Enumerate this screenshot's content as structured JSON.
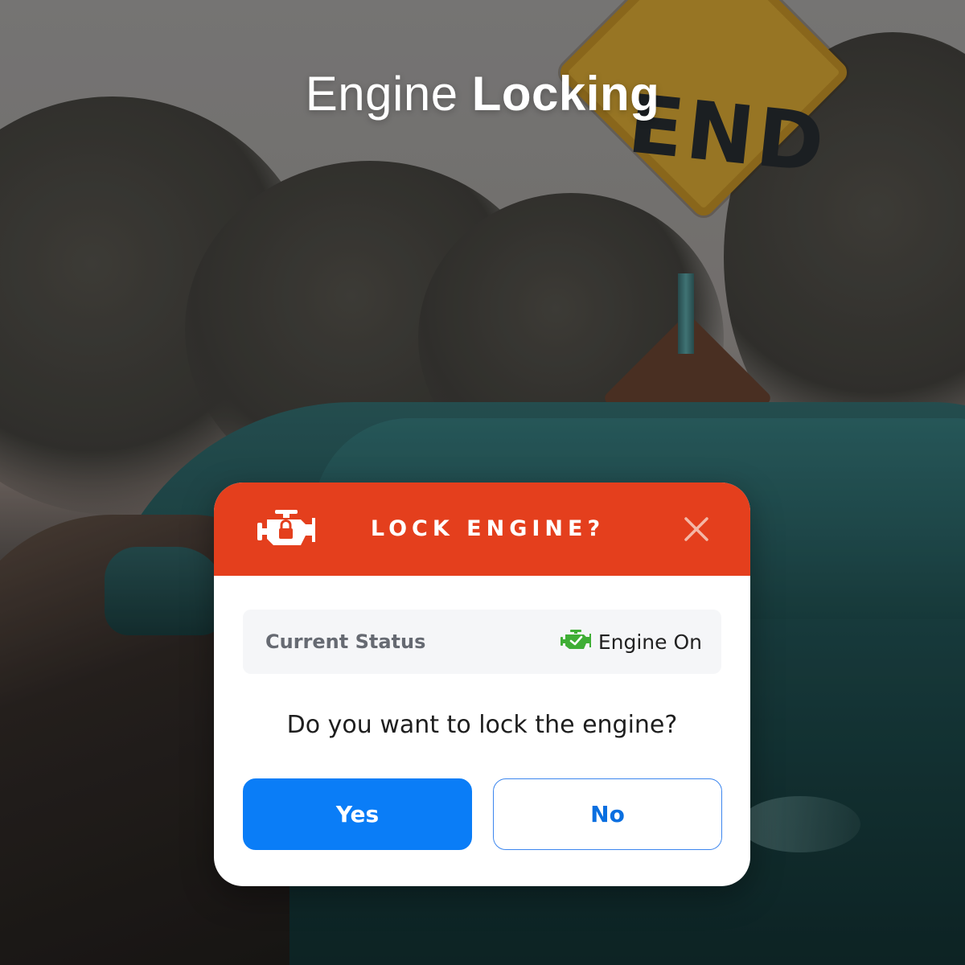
{
  "headline": {
    "light": "Engine",
    "bold": "Locking"
  },
  "background": {
    "sign_text": "END"
  },
  "dialog": {
    "title": "LOCK ENGINE?",
    "header_icon": "engine-lock-icon",
    "close_icon": "close-icon",
    "status": {
      "label": "Current Status",
      "value": "Engine On",
      "value_icon": "engine-check-icon"
    },
    "question": "Do you want to lock the engine?",
    "yes_label": "Yes",
    "no_label": "No"
  },
  "colors": {
    "header": "#e43f1d",
    "primary_button": "#0a7df7",
    "status_ok": "#3fae35",
    "status_row_bg": "#f5f6f8"
  }
}
